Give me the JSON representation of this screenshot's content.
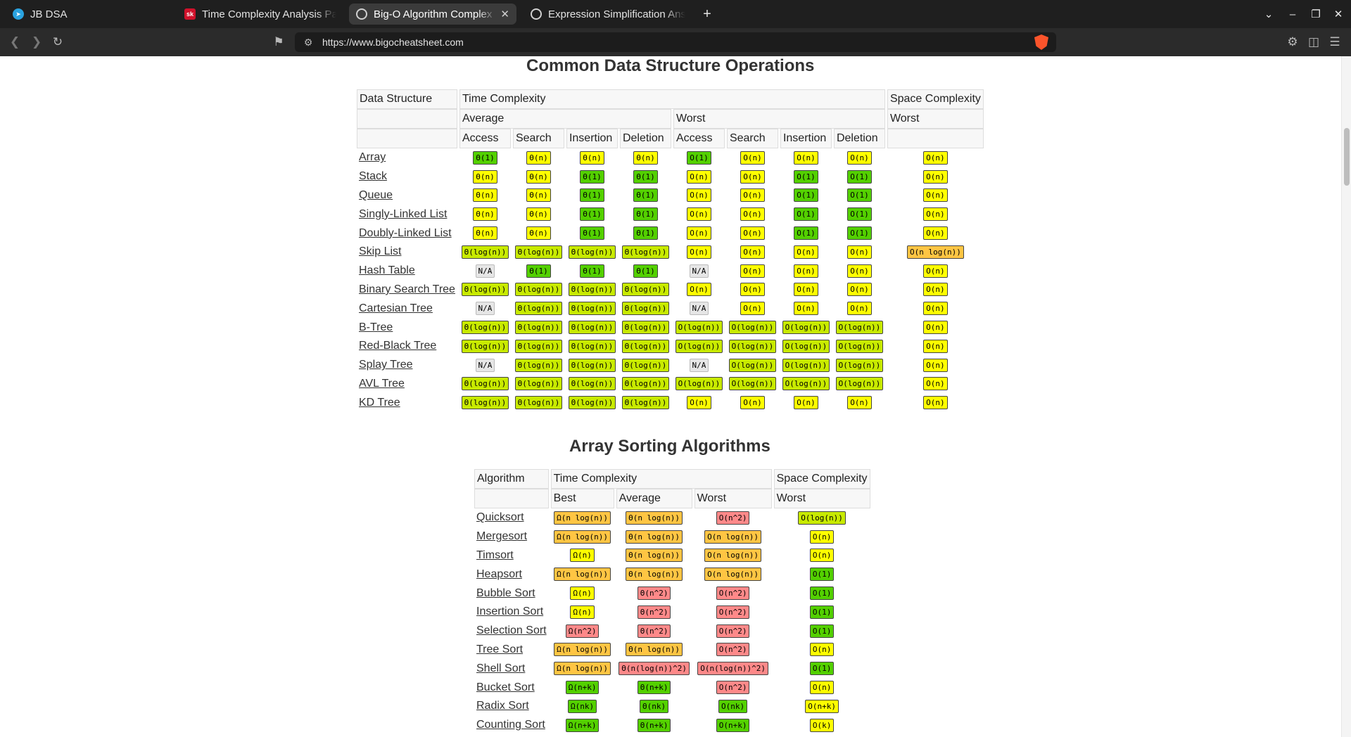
{
  "browser": {
    "tabs": [
      {
        "title": "JB DSA",
        "active": false
      },
      {
        "title": "Time Complexity Analysis Pa",
        "active": false
      },
      {
        "title": "Big-O Algorithm Complex",
        "active": true
      },
      {
        "title": "Expression Simplification Ans",
        "active": false
      }
    ],
    "new_tab_symbol": "+",
    "url": "https://www.bigocheatsheet.com",
    "accent_color": "#fb542b"
  },
  "ds_section": {
    "title": "Common Data Structure Operations",
    "header": {
      "col0": "Data Structure",
      "time": "Time Complexity",
      "space": "Space Complexity",
      "average": "Average",
      "worst": "Worst",
      "space_worst": "Worst",
      "ops": [
        "Access",
        "Search",
        "Insertion",
        "Deletion",
        "Access",
        "Search",
        "Insertion",
        "Deletion"
      ]
    },
    "rows": [
      {
        "name": "Array",
        "cells": [
          [
            "Θ(1)",
            "green"
          ],
          [
            "Θ(n)",
            "yellow"
          ],
          [
            "Θ(n)",
            "yellow"
          ],
          [
            "Θ(n)",
            "yellow"
          ],
          [
            "O(1)",
            "green"
          ],
          [
            "O(n)",
            "yellow"
          ],
          [
            "O(n)",
            "yellow"
          ],
          [
            "O(n)",
            "yellow"
          ],
          [
            "O(n)",
            "yellow"
          ]
        ]
      },
      {
        "name": "Stack",
        "cells": [
          [
            "Θ(n)",
            "yellow"
          ],
          [
            "Θ(n)",
            "yellow"
          ],
          [
            "Θ(1)",
            "green"
          ],
          [
            "Θ(1)",
            "green"
          ],
          [
            "O(n)",
            "yellow"
          ],
          [
            "O(n)",
            "yellow"
          ],
          [
            "O(1)",
            "green"
          ],
          [
            "O(1)",
            "green"
          ],
          [
            "O(n)",
            "yellow"
          ]
        ]
      },
      {
        "name": "Queue",
        "cells": [
          [
            "Θ(n)",
            "yellow"
          ],
          [
            "Θ(n)",
            "yellow"
          ],
          [
            "Θ(1)",
            "green"
          ],
          [
            "Θ(1)",
            "green"
          ],
          [
            "O(n)",
            "yellow"
          ],
          [
            "O(n)",
            "yellow"
          ],
          [
            "O(1)",
            "green"
          ],
          [
            "O(1)",
            "green"
          ],
          [
            "O(n)",
            "yellow"
          ]
        ]
      },
      {
        "name": "Singly-Linked List",
        "cells": [
          [
            "Θ(n)",
            "yellow"
          ],
          [
            "Θ(n)",
            "yellow"
          ],
          [
            "Θ(1)",
            "green"
          ],
          [
            "Θ(1)",
            "green"
          ],
          [
            "O(n)",
            "yellow"
          ],
          [
            "O(n)",
            "yellow"
          ],
          [
            "O(1)",
            "green"
          ],
          [
            "O(1)",
            "green"
          ],
          [
            "O(n)",
            "yellow"
          ]
        ]
      },
      {
        "name": "Doubly-Linked List",
        "cells": [
          [
            "Θ(n)",
            "yellow"
          ],
          [
            "Θ(n)",
            "yellow"
          ],
          [
            "Θ(1)",
            "green"
          ],
          [
            "Θ(1)",
            "green"
          ],
          [
            "O(n)",
            "yellow"
          ],
          [
            "O(n)",
            "yellow"
          ],
          [
            "O(1)",
            "green"
          ],
          [
            "O(1)",
            "green"
          ],
          [
            "O(n)",
            "yellow"
          ]
        ]
      },
      {
        "name": "Skip List",
        "cells": [
          [
            "Θ(log(n))",
            "yellow-green"
          ],
          [
            "Θ(log(n))",
            "yellow-green"
          ],
          [
            "Θ(log(n))",
            "yellow-green"
          ],
          [
            "Θ(log(n))",
            "yellow-green"
          ],
          [
            "O(n)",
            "yellow"
          ],
          [
            "O(n)",
            "yellow"
          ],
          [
            "O(n)",
            "yellow"
          ],
          [
            "O(n)",
            "yellow"
          ],
          [
            "O(n log(n))",
            "orange"
          ]
        ]
      },
      {
        "name": "Hash Table",
        "cells": [
          [
            "N/A",
            "gray"
          ],
          [
            "Θ(1)",
            "green"
          ],
          [
            "Θ(1)",
            "green"
          ],
          [
            "Θ(1)",
            "green"
          ],
          [
            "N/A",
            "gray"
          ],
          [
            "O(n)",
            "yellow"
          ],
          [
            "O(n)",
            "yellow"
          ],
          [
            "O(n)",
            "yellow"
          ],
          [
            "O(n)",
            "yellow"
          ]
        ]
      },
      {
        "name": "Binary Search Tree",
        "cells": [
          [
            "Θ(log(n))",
            "yellow-green"
          ],
          [
            "Θ(log(n))",
            "yellow-green"
          ],
          [
            "Θ(log(n))",
            "yellow-green"
          ],
          [
            "Θ(log(n))",
            "yellow-green"
          ],
          [
            "O(n)",
            "yellow"
          ],
          [
            "O(n)",
            "yellow"
          ],
          [
            "O(n)",
            "yellow"
          ],
          [
            "O(n)",
            "yellow"
          ],
          [
            "O(n)",
            "yellow"
          ]
        ]
      },
      {
        "name": "Cartesian Tree",
        "cells": [
          [
            "N/A",
            "gray"
          ],
          [
            "Θ(log(n))",
            "yellow-green"
          ],
          [
            "Θ(log(n))",
            "yellow-green"
          ],
          [
            "Θ(log(n))",
            "yellow-green"
          ],
          [
            "N/A",
            "gray"
          ],
          [
            "O(n)",
            "yellow"
          ],
          [
            "O(n)",
            "yellow"
          ],
          [
            "O(n)",
            "yellow"
          ],
          [
            "O(n)",
            "yellow"
          ]
        ]
      },
      {
        "name": "B-Tree",
        "cells": [
          [
            "Θ(log(n))",
            "yellow-green"
          ],
          [
            "Θ(log(n))",
            "yellow-green"
          ],
          [
            "Θ(log(n))",
            "yellow-green"
          ],
          [
            "Θ(log(n))",
            "yellow-green"
          ],
          [
            "O(log(n))",
            "yellow-green"
          ],
          [
            "O(log(n))",
            "yellow-green"
          ],
          [
            "O(log(n))",
            "yellow-green"
          ],
          [
            "O(log(n))",
            "yellow-green"
          ],
          [
            "O(n)",
            "yellow"
          ]
        ]
      },
      {
        "name": "Red-Black Tree",
        "cells": [
          [
            "Θ(log(n))",
            "yellow-green"
          ],
          [
            "Θ(log(n))",
            "yellow-green"
          ],
          [
            "Θ(log(n))",
            "yellow-green"
          ],
          [
            "Θ(log(n))",
            "yellow-green"
          ],
          [
            "O(log(n))",
            "yellow-green"
          ],
          [
            "O(log(n))",
            "yellow-green"
          ],
          [
            "O(log(n))",
            "yellow-green"
          ],
          [
            "O(log(n))",
            "yellow-green"
          ],
          [
            "O(n)",
            "yellow"
          ]
        ]
      },
      {
        "name": "Splay Tree",
        "cells": [
          [
            "N/A",
            "gray"
          ],
          [
            "Θ(log(n))",
            "yellow-green"
          ],
          [
            "Θ(log(n))",
            "yellow-green"
          ],
          [
            "Θ(log(n))",
            "yellow-green"
          ],
          [
            "N/A",
            "gray"
          ],
          [
            "O(log(n))",
            "yellow-green"
          ],
          [
            "O(log(n))",
            "yellow-green"
          ],
          [
            "O(log(n))",
            "yellow-green"
          ],
          [
            "O(n)",
            "yellow"
          ]
        ]
      },
      {
        "name": "AVL Tree",
        "cells": [
          [
            "Θ(log(n))",
            "yellow-green"
          ],
          [
            "Θ(log(n))",
            "yellow-green"
          ],
          [
            "Θ(log(n))",
            "yellow-green"
          ],
          [
            "Θ(log(n))",
            "yellow-green"
          ],
          [
            "O(log(n))",
            "yellow-green"
          ],
          [
            "O(log(n))",
            "yellow-green"
          ],
          [
            "O(log(n))",
            "yellow-green"
          ],
          [
            "O(log(n))",
            "yellow-green"
          ],
          [
            "O(n)",
            "yellow"
          ]
        ]
      },
      {
        "name": "KD Tree",
        "cells": [
          [
            "Θ(log(n))",
            "yellow-green"
          ],
          [
            "Θ(log(n))",
            "yellow-green"
          ],
          [
            "Θ(log(n))",
            "yellow-green"
          ],
          [
            "Θ(log(n))",
            "yellow-green"
          ],
          [
            "O(n)",
            "yellow"
          ],
          [
            "O(n)",
            "yellow"
          ],
          [
            "O(n)",
            "yellow"
          ],
          [
            "O(n)",
            "yellow"
          ],
          [
            "O(n)",
            "yellow"
          ]
        ]
      }
    ]
  },
  "sort_section": {
    "title": "Array Sorting Algorithms",
    "header": {
      "col0": "Algorithm",
      "time": "Time Complexity",
      "space": "Space Complexity",
      "best": "Best",
      "average": "Average",
      "worst": "Worst",
      "space_worst": "Worst"
    },
    "rows": [
      {
        "name": "Quicksort",
        "cells": [
          [
            "Ω(n log(n))",
            "orange"
          ],
          [
            "Θ(n log(n))",
            "orange"
          ],
          [
            "O(n^2)",
            "red"
          ],
          [
            "O(log(n))",
            "yellow-green"
          ]
        ]
      },
      {
        "name": "Mergesort",
        "cells": [
          [
            "Ω(n log(n))",
            "orange"
          ],
          [
            "Θ(n log(n))",
            "orange"
          ],
          [
            "O(n log(n))",
            "orange"
          ],
          [
            "O(n)",
            "yellow"
          ]
        ]
      },
      {
        "name": "Timsort",
        "cells": [
          [
            "Ω(n)",
            "yellow"
          ],
          [
            "Θ(n log(n))",
            "orange"
          ],
          [
            "O(n log(n))",
            "orange"
          ],
          [
            "O(n)",
            "yellow"
          ]
        ]
      },
      {
        "name": "Heapsort",
        "cells": [
          [
            "Ω(n log(n))",
            "orange"
          ],
          [
            "Θ(n log(n))",
            "orange"
          ],
          [
            "O(n log(n))",
            "orange"
          ],
          [
            "O(1)",
            "green"
          ]
        ]
      },
      {
        "name": "Bubble Sort",
        "cells": [
          [
            "Ω(n)",
            "yellow"
          ],
          [
            "Θ(n^2)",
            "red"
          ],
          [
            "O(n^2)",
            "red"
          ],
          [
            "O(1)",
            "green"
          ]
        ]
      },
      {
        "name": "Insertion Sort",
        "cells": [
          [
            "Ω(n)",
            "yellow"
          ],
          [
            "Θ(n^2)",
            "red"
          ],
          [
            "O(n^2)",
            "red"
          ],
          [
            "O(1)",
            "green"
          ]
        ]
      },
      {
        "name": "Selection Sort",
        "cells": [
          [
            "Ω(n^2)",
            "red"
          ],
          [
            "Θ(n^2)",
            "red"
          ],
          [
            "O(n^2)",
            "red"
          ],
          [
            "O(1)",
            "green"
          ]
        ]
      },
      {
        "name": "Tree Sort",
        "cells": [
          [
            "Ω(n log(n))",
            "orange"
          ],
          [
            "Θ(n log(n))",
            "orange"
          ],
          [
            "O(n^2)",
            "red"
          ],
          [
            "O(n)",
            "yellow"
          ]
        ]
      },
      {
        "name": "Shell Sort",
        "cells": [
          [
            "Ω(n log(n))",
            "orange"
          ],
          [
            "Θ(n(log(n))^2)",
            "red"
          ],
          [
            "O(n(log(n))^2)",
            "red"
          ],
          [
            "O(1)",
            "green"
          ]
        ]
      },
      {
        "name": "Bucket Sort",
        "cells": [
          [
            "Ω(n+k)",
            "green"
          ],
          [
            "Θ(n+k)",
            "green"
          ],
          [
            "O(n^2)",
            "red"
          ],
          [
            "O(n)",
            "yellow"
          ]
        ]
      },
      {
        "name": "Radix Sort",
        "cells": [
          [
            "Ω(nk)",
            "green"
          ],
          [
            "Θ(nk)",
            "green"
          ],
          [
            "O(nk)",
            "green"
          ],
          [
            "O(n+k)",
            "yellow"
          ]
        ]
      },
      {
        "name": "Counting Sort",
        "cells": [
          [
            "Ω(n+k)",
            "green"
          ],
          [
            "Θ(n+k)",
            "green"
          ],
          [
            "O(n+k)",
            "green"
          ],
          [
            "O(k)",
            "yellow"
          ]
        ]
      }
    ]
  }
}
